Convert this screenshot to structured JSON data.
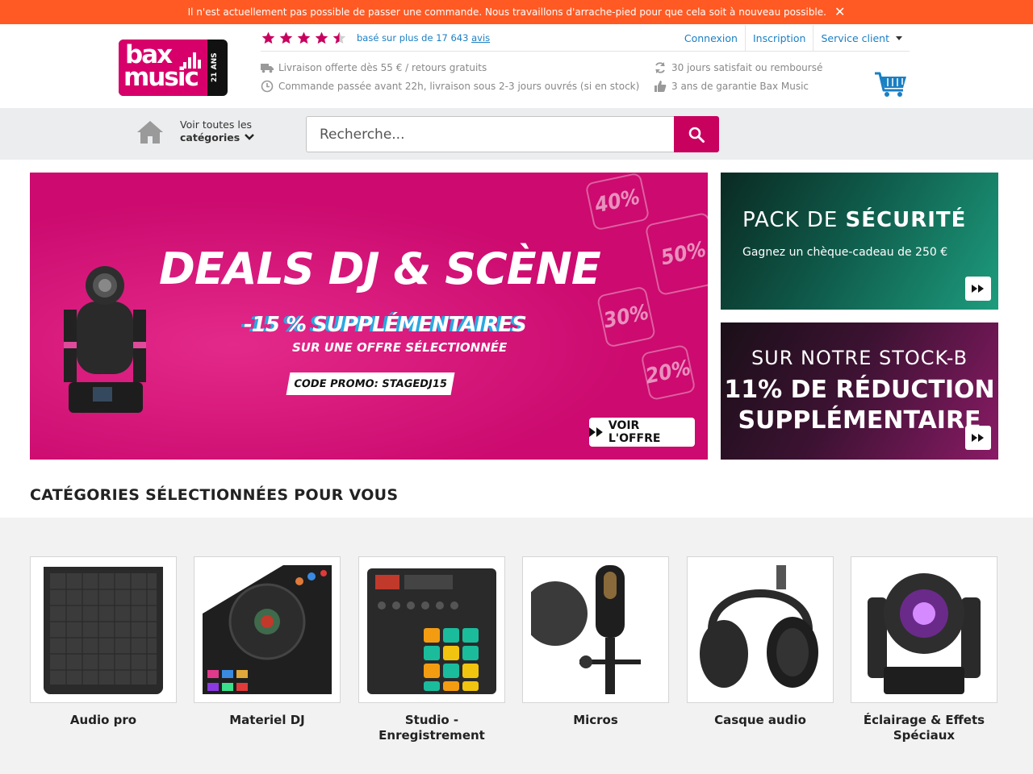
{
  "alert": {
    "message": "Il n'est actuellement pas possible de passer une commande. Nous travaillons d'arrache-pied pour que cela soit à nouveau possible.",
    "close_icon": "close-icon"
  },
  "logo": {
    "line1": "bax",
    "line2": "music",
    "badge": "21 ANS"
  },
  "rating": {
    "stars": 4.5,
    "text": "basé sur plus de 17 643",
    "link": "avis"
  },
  "topnav": {
    "login": "Connexion",
    "signup": "Inscription",
    "service": "Service client"
  },
  "usps": {
    "delivery": "Livraison offerte dès 55 € / retours gratuits",
    "order_time": "Commande passée avant 22h, livraison sous 2-3 jours ouvrés (si en stock)",
    "refund": "30 jours satisfait ou remboursé",
    "warranty": "3 ans de garantie Bax Music"
  },
  "nav": {
    "all_cat_line1": "Voir toutes les",
    "all_cat_line2": "catégories"
  },
  "search": {
    "placeholder": "Recherche..."
  },
  "banner_main": {
    "title": "DEALS DJ & SCÈNE",
    "subtitle": "-15 % SUPPLÉMENTAIRES",
    "subtitle2": "SUR UNE OFFRE SÉLECTIONNÉE",
    "promo": "CODE PROMO: STAGEDJ15",
    "cta": "VOIR L'OFFRE",
    "percents": [
      "40%",
      "50%",
      "30%",
      "20%"
    ]
  },
  "banner_security": {
    "title_plain": "PACK DE ",
    "title_bold": "SÉCURITÉ",
    "subtitle": "Gagnez un chèque-cadeau de 250 €"
  },
  "banner_stock": {
    "line1": "SUR NOTRE STOCK-B",
    "line2": "11% DE RÉDUCTION",
    "line3": "SUPPLÉMENTAIRE"
  },
  "categories": {
    "title": "CATÉGORIES SÉLECTIONNÉES POUR VOUS",
    "items": [
      {
        "label": "Audio pro"
      },
      {
        "label": "Materiel DJ"
      },
      {
        "label": "Studio - Enregistrement"
      },
      {
        "label": "Micros"
      },
      {
        "label": "Casque audio"
      },
      {
        "label": "Éclairage & Effets Spéciaux"
      }
    ]
  },
  "colors": {
    "brand": "#c8005e",
    "alert": "#ff5a23",
    "link": "#1b7fc4"
  }
}
